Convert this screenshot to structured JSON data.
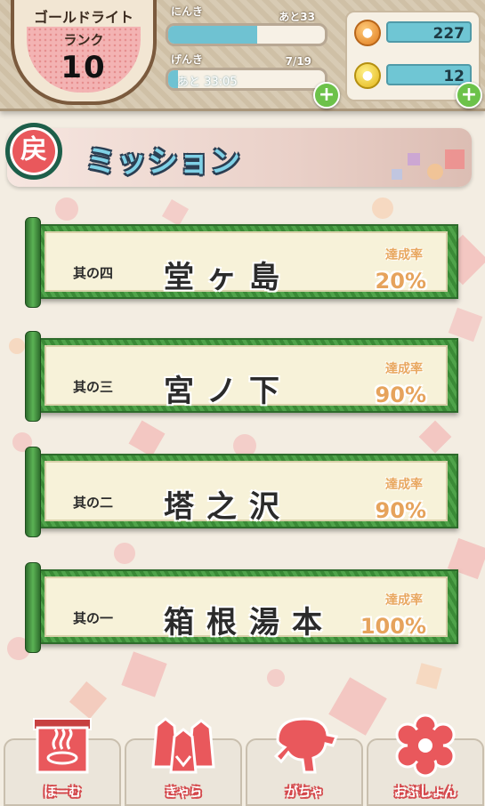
{
  "header": {
    "player_name": "ゴールドライト",
    "rank_label": "ランク",
    "rank_value": "10",
    "ninki_label": "にんき",
    "ninki_remaining": "あと33",
    "ninki_progress": 0.57,
    "genki_label": "げんき",
    "genki_count": "7/19",
    "genki_timer": "あと 33:05",
    "genki_progress": 0.06,
    "currency_orange": "227",
    "currency_gold": "12"
  },
  "mission": {
    "back_label": "戻",
    "title": "ミッション",
    "items": [
      {
        "num": "其の四",
        "name": "堂ヶ島",
        "rate_label": "達成率",
        "rate": "20%"
      },
      {
        "num": "其の三",
        "name": "宮ノ下",
        "rate_label": "達成率",
        "rate": "90%"
      },
      {
        "num": "其の二",
        "name": "塔之沢",
        "rate_label": "達成率",
        "rate": "90%"
      },
      {
        "num": "其の一",
        "name": "箱根湯本",
        "rate_label": "達成率",
        "rate": "100%"
      }
    ]
  },
  "tabs": [
    {
      "label": "ほーむ",
      "icon": "onsen-icon"
    },
    {
      "label": "きゃら",
      "icon": "characters-icon"
    },
    {
      "label": "がちゃ",
      "icon": "gacha-icon"
    },
    {
      "label": "おぷしょん",
      "icon": "flower-icon"
    }
  ],
  "colors": {
    "accent_red": "#e9585c",
    "scroll_green": "#3f8f3a",
    "bar_blue": "#6fc2d2"
  }
}
